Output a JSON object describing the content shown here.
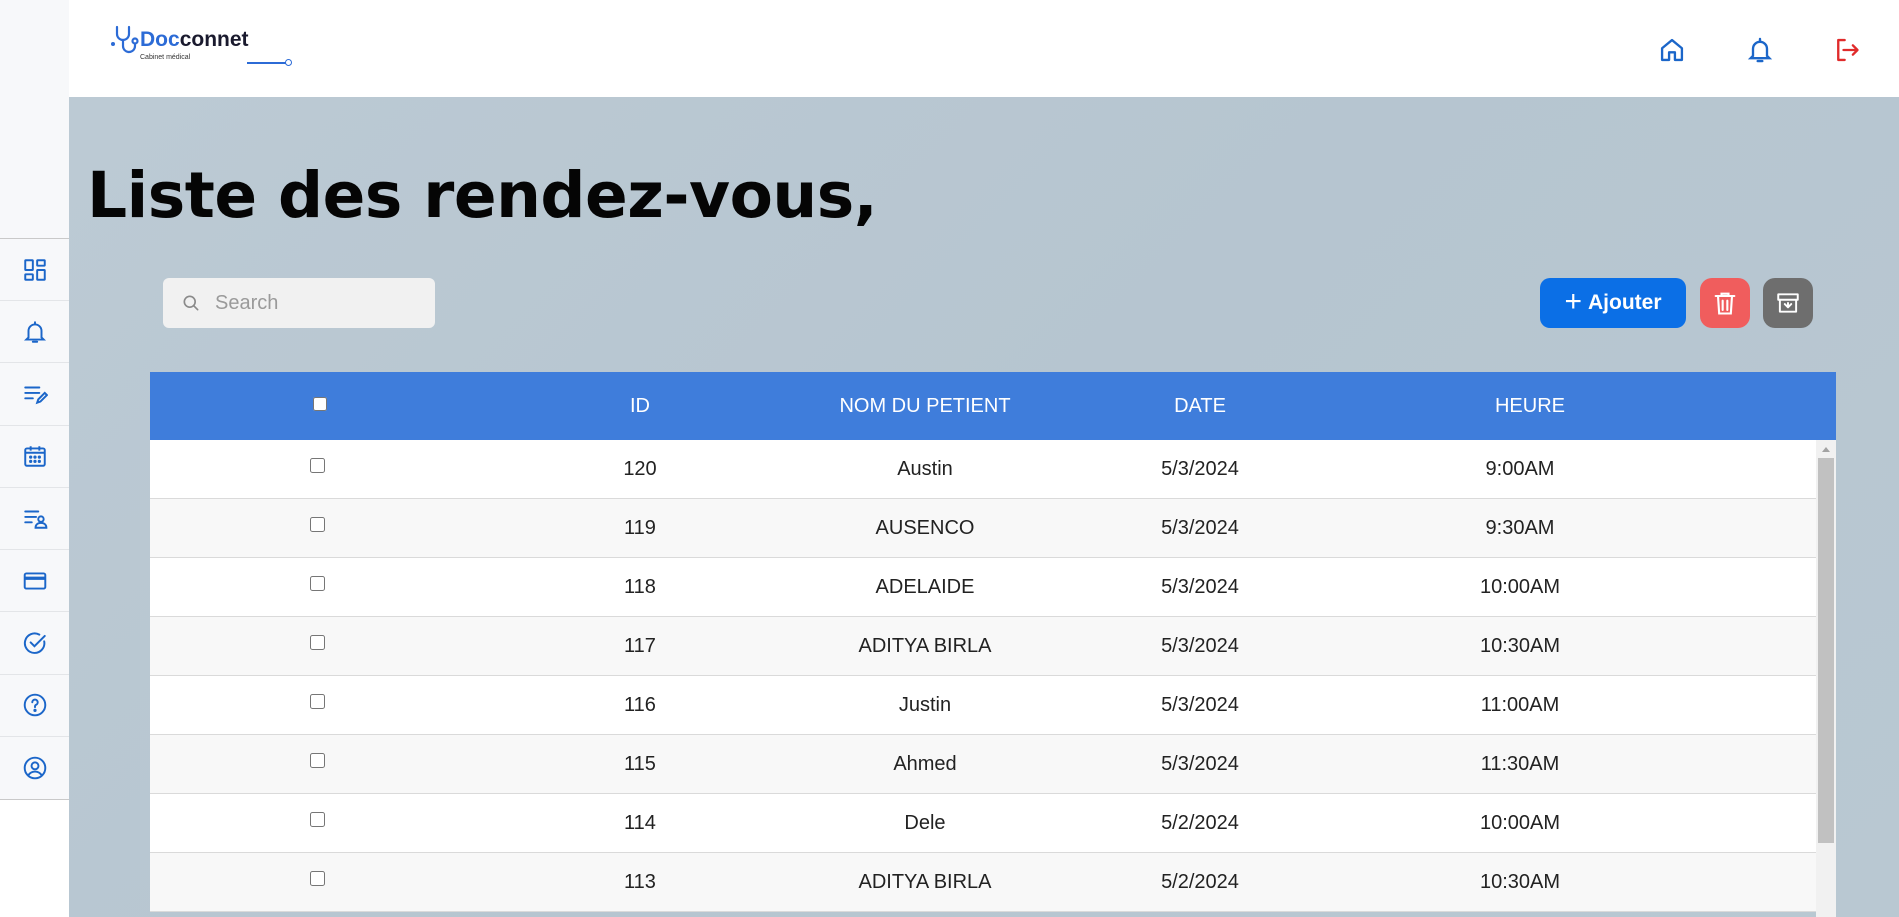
{
  "header": {
    "logo": {
      "text_accent": "Doc",
      "text_rest": "connet",
      "subtitle": "Cabinet médical"
    },
    "icons": {
      "home": "home-icon",
      "notifications": "bell-icon",
      "logout": "logout-icon"
    }
  },
  "sidebar": {
    "items": [
      {
        "name": "dashboard",
        "icon": "dashboard-icon"
      },
      {
        "name": "notifications",
        "icon": "bell-icon"
      },
      {
        "name": "notes",
        "icon": "edit-list-icon"
      },
      {
        "name": "calendar",
        "icon": "calendar-icon"
      },
      {
        "name": "patients",
        "icon": "person-list-icon"
      },
      {
        "name": "payments",
        "icon": "credit-card-icon"
      },
      {
        "name": "tasks",
        "icon": "check-circle-icon"
      },
      {
        "name": "help",
        "icon": "help-circle-icon"
      },
      {
        "name": "profile",
        "icon": "user-circle-icon"
      }
    ]
  },
  "main": {
    "title": "Liste des rendez-vous,",
    "search": {
      "placeholder": "Search",
      "value": ""
    },
    "buttons": {
      "add": "Ajouter",
      "delete_icon": "trash-icon",
      "archive_icon": "archive-icon"
    }
  },
  "table": {
    "columns": [
      "ID",
      "NOM DU PETIENT",
      "DATE",
      "HEURE"
    ],
    "rows": [
      {
        "id": "120",
        "name": "Austin",
        "date": "5/3/2024",
        "time": "9:00AM"
      },
      {
        "id": "119",
        "name": "AUSENCO",
        "date": "5/3/2024",
        "time": "9:30AM"
      },
      {
        "id": "118",
        "name": "ADELAIDE",
        "date": "5/3/2024",
        "time": "10:00AM"
      },
      {
        "id": "117",
        "name": "ADITYA BIRLA",
        "date": "5/3/2024",
        "time": "10:30AM"
      },
      {
        "id": "116",
        "name": "Justin",
        "date": "5/3/2024",
        "time": "11:00AM"
      },
      {
        "id": "115",
        "name": "Ahmed",
        "date": "5/3/2024",
        "time": "11:30AM"
      },
      {
        "id": "114",
        "name": "Dele",
        "date": "5/2/2024",
        "time": "10:00AM"
      },
      {
        "id": "113",
        "name": "ADITYA BIRLA",
        "date": "5/2/2024",
        "time": "10:30AM"
      }
    ]
  },
  "colors": {
    "primary": "#0b6fe6",
    "table_header": "#3f7ddb",
    "delete": "#f05d5d",
    "archive": "#6e6e6e",
    "logout": "#e02b2b",
    "icon_blue": "#1b66c9"
  }
}
